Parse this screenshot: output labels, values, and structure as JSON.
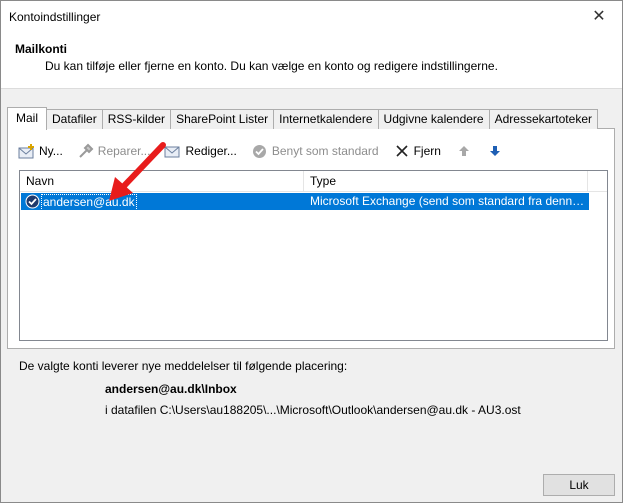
{
  "window": {
    "title": "Kontoindstillinger",
    "close_glyph": "✕"
  },
  "header": {
    "title": "Mailkonti",
    "subtitle": "Du kan tilføje eller fjerne en konto. Du kan vælge en konto og redigere indstillingerne."
  },
  "tabs": [
    {
      "label": "Mail",
      "active": true
    },
    {
      "label": "Datafiler"
    },
    {
      "label": "RSS-kilder"
    },
    {
      "label": "SharePoint Lister"
    },
    {
      "label": "Internetkalendere"
    },
    {
      "label": "Udgivne kalendere"
    },
    {
      "label": "Adressekartoteker"
    }
  ],
  "toolbar": {
    "new_label": "Ny...",
    "repair_label": "Reparer...",
    "change_label": "Rediger...",
    "default_label": "Benyt som standard",
    "remove_label": "Fjern"
  },
  "list": {
    "columns": {
      "name": "Navn",
      "type": "Type"
    },
    "rows": [
      {
        "name": "andersen@au.dk",
        "type": "Microsoft Exchange (send som standard fra denne ..."
      }
    ]
  },
  "info": {
    "label": "De valgte konti leverer nye meddelelser til følgende placering:",
    "folder": "andersen@au.dk\\Inbox",
    "path": "i datafilen C:\\Users\\au188205\\...\\Microsoft\\Outlook\\andersen@au.dk - AU3.ost"
  },
  "buttons": {
    "close_label": "Luk"
  },
  "colors": {
    "selection": "#0078d7",
    "annotation_arrow": "#e81c1c",
    "accent": "#1e5fb4"
  }
}
